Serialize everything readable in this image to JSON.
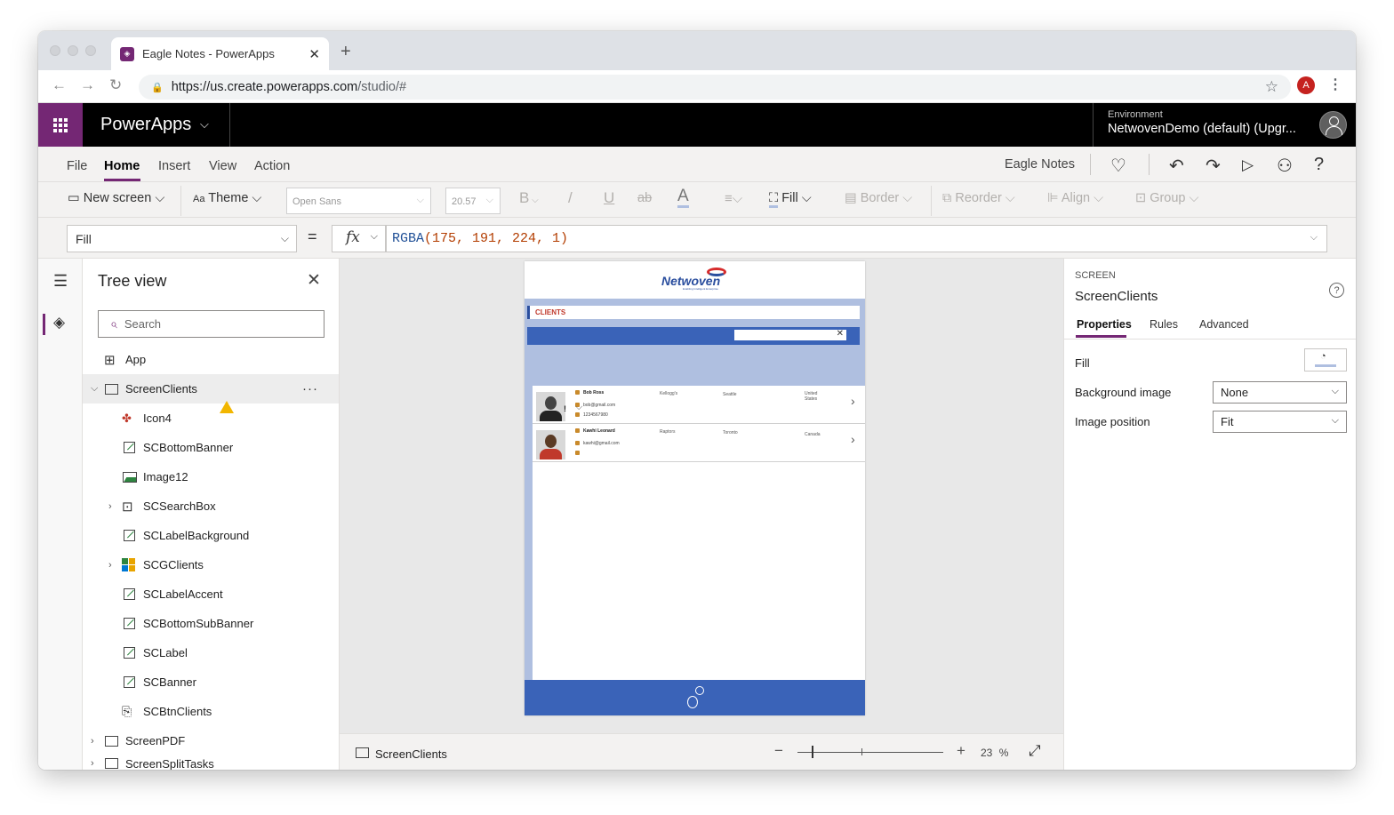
{
  "browser": {
    "tab_title": "Eagle Notes - PowerApps",
    "new_tab": "+",
    "url_domain": "https://us.create.powerapps.com",
    "url_path": "/studio/#",
    "profile_initial": "A"
  },
  "header": {
    "app_title": "PowerApps",
    "environment_label": "Environment",
    "environment_name": "NetwovenDemo (default) (Upgr..."
  },
  "menu": {
    "items": [
      "File",
      "Home",
      "Insert",
      "View",
      "Action"
    ],
    "active": "Home",
    "app_name": "Eagle Notes"
  },
  "ribbon": {
    "new_screen": "New screen",
    "theme": "Theme",
    "font": "Open Sans",
    "font_size": "20.57",
    "bold": "B",
    "fill": "Fill",
    "border": "Border",
    "reorder": "Reorder",
    "align": "Align",
    "group": "Group"
  },
  "formula": {
    "property": "Fill",
    "equals": "=",
    "fx": "fx",
    "fn": "RGBA",
    "args": "(175, 191, 224, 1)"
  },
  "tree": {
    "title": "Tree view",
    "search_placeholder": "Search",
    "items": [
      {
        "label": "App"
      },
      {
        "label": "ScreenClients",
        "more": "···"
      },
      {
        "label": "Icon4"
      },
      {
        "label": "SCBottomBanner"
      },
      {
        "label": "Image12"
      },
      {
        "label": "SCSearchBox"
      },
      {
        "label": "SCLabelBackground"
      },
      {
        "label": "SCGClients"
      },
      {
        "label": "SCLabelAccent"
      },
      {
        "label": "SCBottomSubBanner"
      },
      {
        "label": "SCLabel"
      },
      {
        "label": "SCBanner"
      },
      {
        "label": "SCBtnClients"
      },
      {
        "label": "ScreenPDF"
      },
      {
        "label": "ScreenSplitTasks"
      }
    ]
  },
  "canvas": {
    "logo": "Netwoven",
    "logo_tagline": "Enabling Intelligent Enterprise",
    "section_label": "CLIENTS",
    "search_clear": "✕",
    "fill_color": "#afbfe0",
    "banner_color": "#3a63b8",
    "clients": [
      {
        "name": "Bob Ross",
        "email": "bob@gmail.com",
        "phone": "1234567980",
        "company": "Kellogg's",
        "city": "Seattle",
        "country": "United States"
      },
      {
        "name": "Kawhi Leonard",
        "email": "kawhi@gmail.com",
        "phone": "",
        "company": "Raptors",
        "city": "Toronto",
        "country": "Canada"
      }
    ]
  },
  "statusbar": {
    "screen_name": "ScreenClients",
    "zoom_value": "23",
    "zoom_unit": "%"
  },
  "properties": {
    "type": "SCREEN",
    "name": "ScreenClients",
    "tabs": [
      "Properties",
      "Rules",
      "Advanced"
    ],
    "fill_label": "Fill",
    "background_image_label": "Background image",
    "background_image_value": "None",
    "image_position_label": "Image position",
    "image_position_value": "Fit"
  }
}
